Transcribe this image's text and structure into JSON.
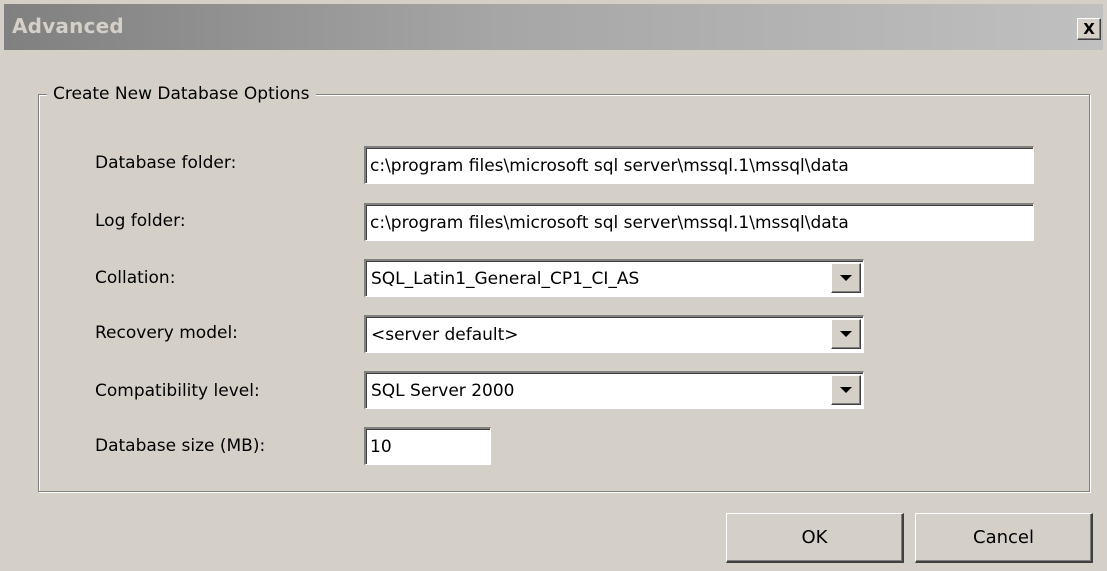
{
  "window": {
    "title": "Advanced",
    "close_label": "X"
  },
  "group": {
    "legend": "Create New Database Options"
  },
  "fields": {
    "database_folder": {
      "label": "Database folder:",
      "value": "c:\\program files\\microsoft sql server\\mssql.1\\mssql\\data"
    },
    "log_folder": {
      "label": "Log folder:",
      "value": "c:\\program files\\microsoft sql server\\mssql.1\\mssql\\data"
    },
    "collation": {
      "label": "Collation:",
      "value": "SQL_Latin1_General_CP1_CI_AS"
    },
    "recovery_model": {
      "label": "Recovery model:",
      "value": "<server default>"
    },
    "compatibility_level": {
      "label": "Compatibility level:",
      "value": "SQL Server 2000"
    },
    "database_size": {
      "label": "Database size (MB):",
      "value": "10"
    }
  },
  "buttons": {
    "ok": "OK",
    "cancel": "Cancel"
  },
  "icons": {
    "close": "close-icon",
    "dropdown": "chevron-down-icon"
  },
  "colors": {
    "dialog_background": "#d4d0c8",
    "title_gradient_start": "#808080",
    "title_gradient_end": "#c0c0c0",
    "title_text": "#d4d0c8"
  }
}
